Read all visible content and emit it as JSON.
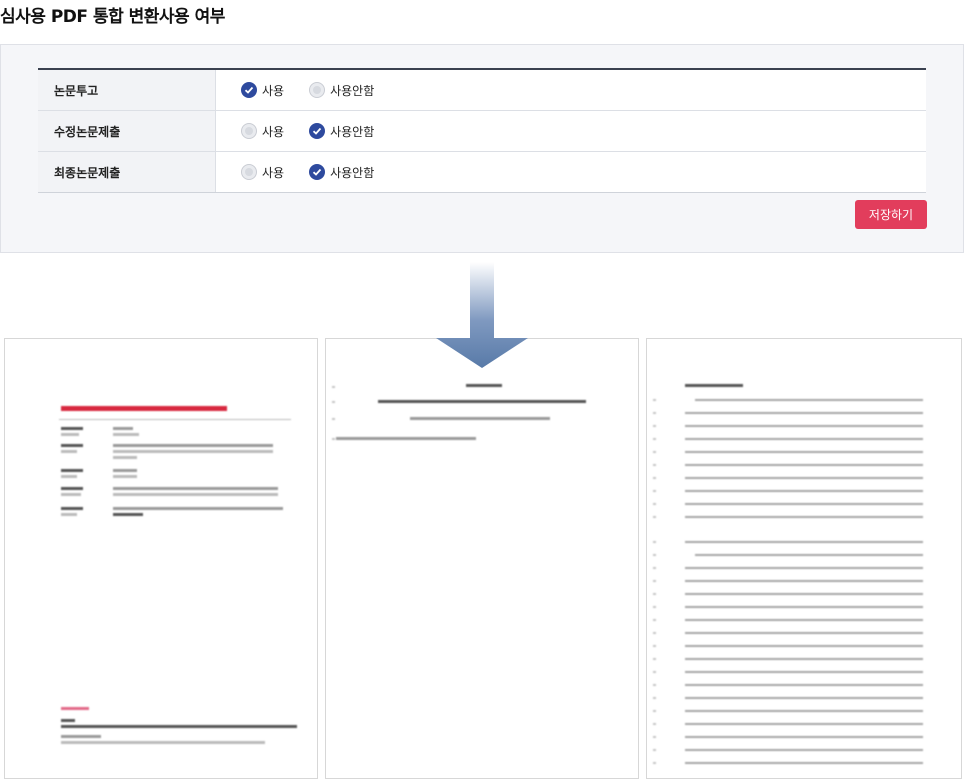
{
  "title": "심사용 PDF 통합 변환사용 여부",
  "table": {
    "rows": [
      {
        "label": "논문투고",
        "options": [
          {
            "label": "사용",
            "checked": true
          },
          {
            "label": "사용안함",
            "checked": false
          }
        ]
      },
      {
        "label": "수정논문제출",
        "options": [
          {
            "label": "사용",
            "checked": false
          },
          {
            "label": "사용안함",
            "checked": true
          }
        ]
      },
      {
        "label": "최종논문제출",
        "options": [
          {
            "label": "사용",
            "checked": false
          },
          {
            "label": "사용안함",
            "checked": true
          }
        ]
      }
    ]
  },
  "save_label": "저장하기",
  "colors": {
    "accent": "#2e4a9e",
    "save": "#e23d5c",
    "arrow": "#5b7aa6"
  },
  "icons": {
    "checked": "check-circle-icon",
    "unchecked": "radio-empty-icon",
    "arrow": "arrow-down-icon"
  },
  "pages": [
    {
      "name": "cover-page",
      "lines": 0
    },
    {
      "name": "title-page",
      "lines": 0
    },
    {
      "name": "case-presentation-page",
      "lines": 0
    }
  ]
}
